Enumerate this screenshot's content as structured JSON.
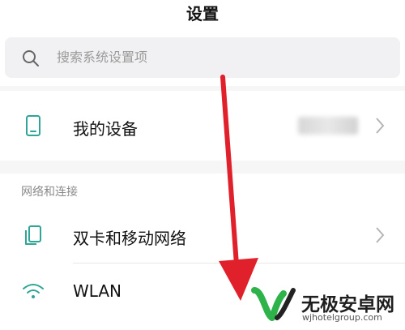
{
  "header": {
    "title": "设置"
  },
  "search": {
    "placeholder": "搜索系统设置项",
    "icon": "search-icon"
  },
  "rows": {
    "my_device": {
      "label": "我的设备",
      "icon": "phone-icon",
      "value": ""
    },
    "network_section": {
      "header": "网络和连接"
    },
    "dual_sim": {
      "label": "双卡和移动网络",
      "icon": "sim-cards-icon"
    },
    "wlan": {
      "label": "WLAN",
      "icon": "wifi-icon"
    }
  },
  "annotation": {
    "arrow_color": "#e0202a",
    "direction": "down"
  },
  "watermark": {
    "brand": "无极安卓网",
    "url": "wjhotelgroup.com",
    "logo_color": "#2db34a"
  },
  "colors": {
    "accent": "#2ea596",
    "separator": "#e7e7e7",
    "band": "#f6f6f6"
  }
}
